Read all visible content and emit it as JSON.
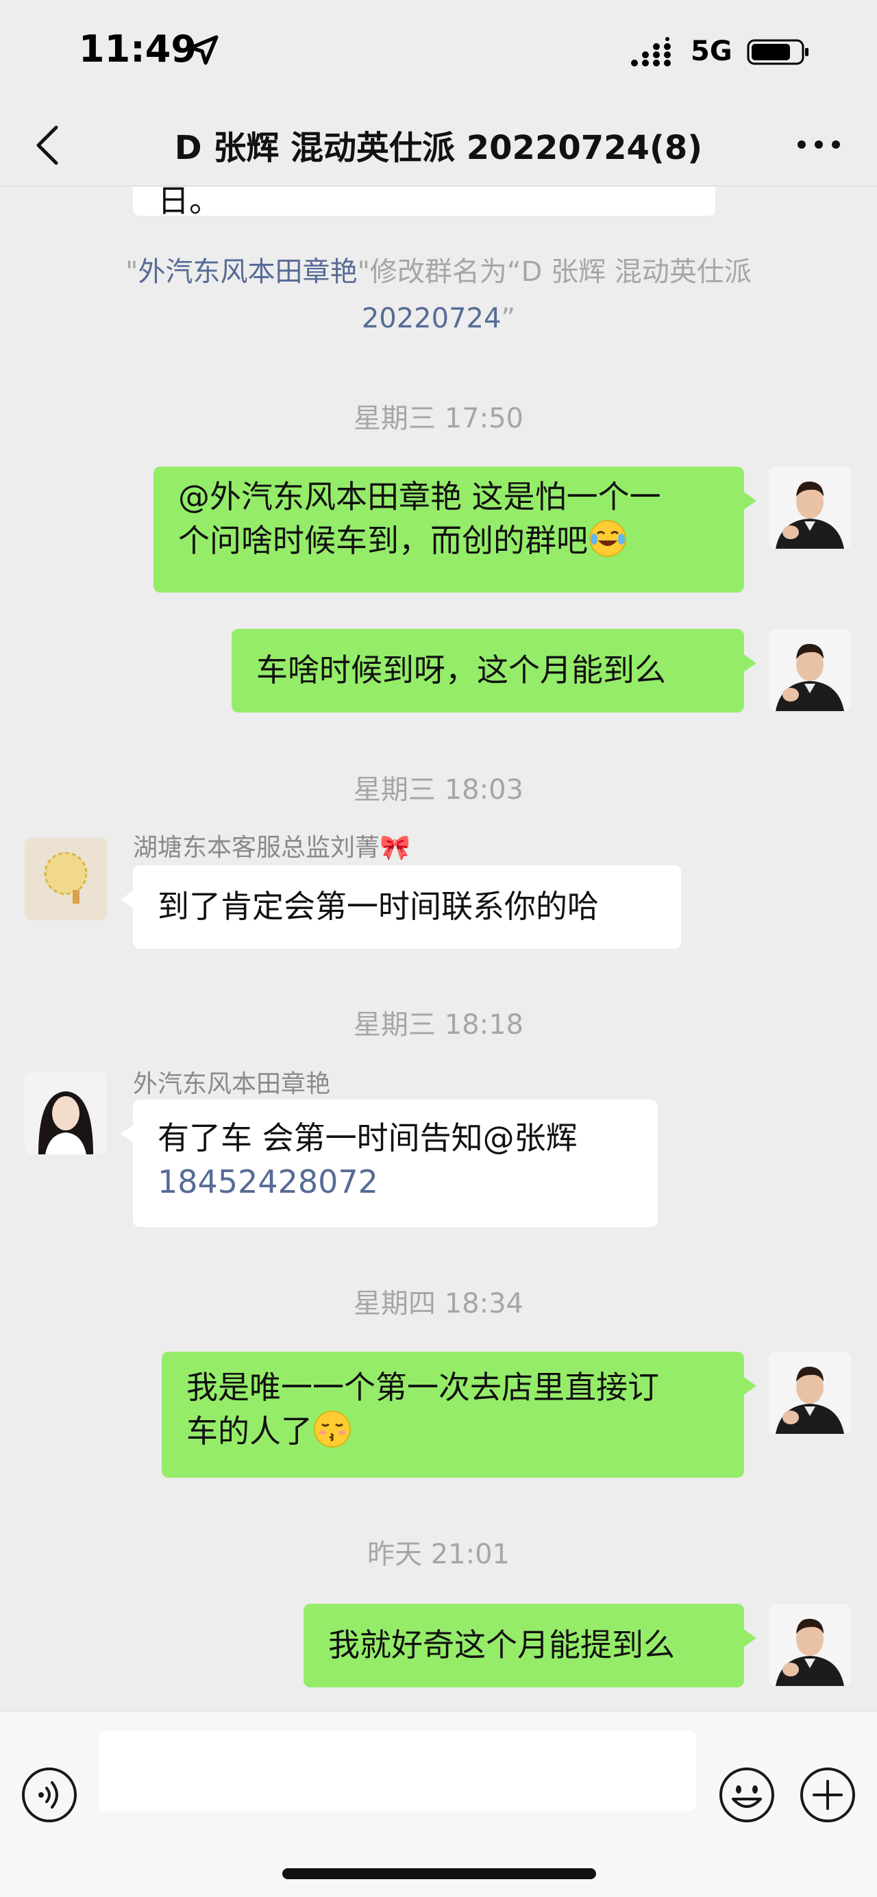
{
  "status_bar": {
    "time": "11:49",
    "network": "5G"
  },
  "nav": {
    "title": "D 张辉 混动英仕派 20220724(8)"
  },
  "chat": {
    "partial_top_text": "日。",
    "system_message": {
      "quote_open": "\"",
      "actor": "外汽东风本田章艳",
      "action": "\"修改群名为“D 张辉 混动英仕派",
      "new_name": "20220724",
      "quote_close": "”"
    },
    "ts1": "星期三 17:50",
    "msg1_line1": "@外汽东风本田章艳 这是怕一个一",
    "msg1_line2": "个问啥时候车到，而创的群吧",
    "msg2": "车啥时候到呀，这个月能到么",
    "ts2": "星期三 18:03",
    "sender_kf": "湖塘东本客服总监刘菁🎀",
    "msg3": "到了肯定会第一时间联系你的哈",
    "ts3": "星期三 18:18",
    "sender_zy": "外汽东风本田章艳",
    "msg4_line1": "有了车 会第一时间告知@张辉",
    "msg4_phone": "18452428072",
    "ts4": "星期四 18:34",
    "msg5_line1": "我是唯一一个第一次去店里直接订",
    "msg5_line2": "车的人了",
    "ts5": "昨天 21:01",
    "msg6": "我就好奇这个月能提到么"
  },
  "colors": {
    "accent_link": "#576b95",
    "bubble_green": "#95ec69",
    "bg": "#ededed"
  },
  "icons": [
    "location-arrow-icon",
    "signal-icon",
    "battery-icon",
    "back-chevron-icon",
    "more-dots-icon",
    "voice-icon",
    "emoji-icon",
    "plus-icon",
    "laughing-tears-emoji",
    "kissing-emoji"
  ]
}
